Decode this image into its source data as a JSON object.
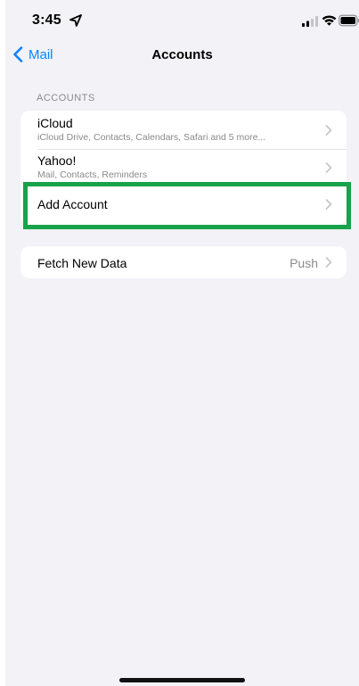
{
  "status_bar": {
    "time": "3:45"
  },
  "nav": {
    "back_label": "Mail",
    "title": "Accounts"
  },
  "accounts_section": {
    "header": "ACCOUNTS",
    "rows": [
      {
        "title": "iCloud",
        "subtitle": "iCloud Drive, Contacts, Calendars, Safari and 5 more..."
      },
      {
        "title": "Yahoo!",
        "subtitle": "Mail, Contacts, Reminders"
      },
      {
        "title": "Add Account"
      }
    ]
  },
  "fetch_section": {
    "title": "Fetch New Data",
    "value": "Push"
  },
  "colors": {
    "background": "#f2f2f7",
    "accent": "#0a84ff",
    "highlight": "#16a34a",
    "secondary_text": "#8a8a8e"
  },
  "icons": [
    "location-arrow-icon",
    "cellular-signal-icon",
    "wifi-icon",
    "battery-icon",
    "chevron-left-icon",
    "chevron-right-icon"
  ]
}
